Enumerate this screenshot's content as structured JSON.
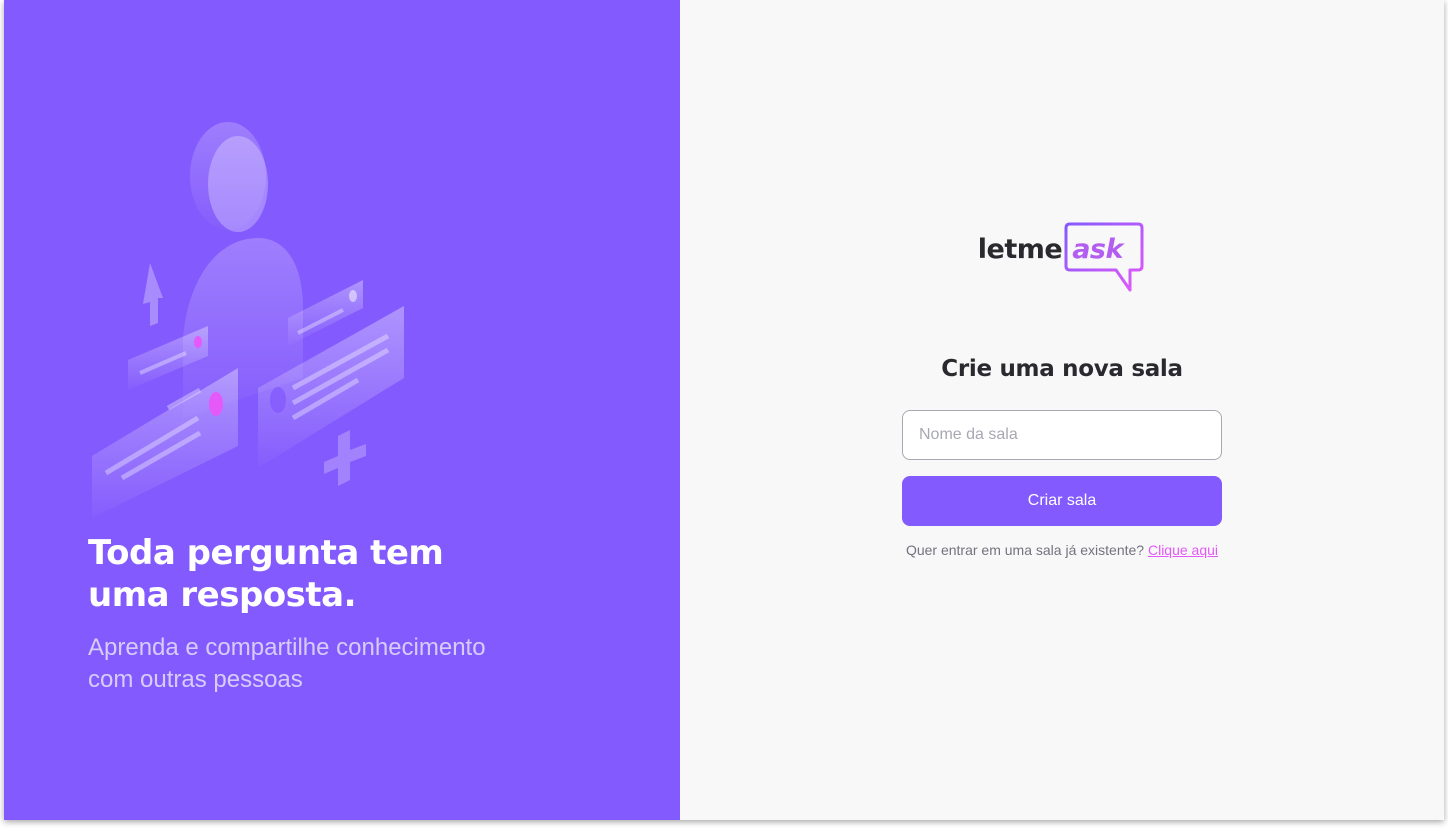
{
  "aside": {
    "title": "Toda pergunta tem uma resposta.",
    "subtitle": "Aprenda e compartilhe conhecimento com outras pessoas",
    "illustration_icon": "qa-illustration"
  },
  "main": {
    "logo": {
      "text_plain": "letme",
      "text_accent": "ask",
      "icon": "speech-bubble-icon"
    },
    "heading": "Crie uma nova sala",
    "room_input": {
      "value": "",
      "placeholder": "Nome da sala"
    },
    "create_button": "Criar sala",
    "join_prompt": "Quer entrar em uma sala já existente?",
    "join_link": "Clique aqui"
  },
  "colors": {
    "brand_purple": "#835afd",
    "accent_pink": "#e559f9",
    "background": "#f8f8f8",
    "text_dark": "#29292e",
    "text_muted": "#737380"
  }
}
